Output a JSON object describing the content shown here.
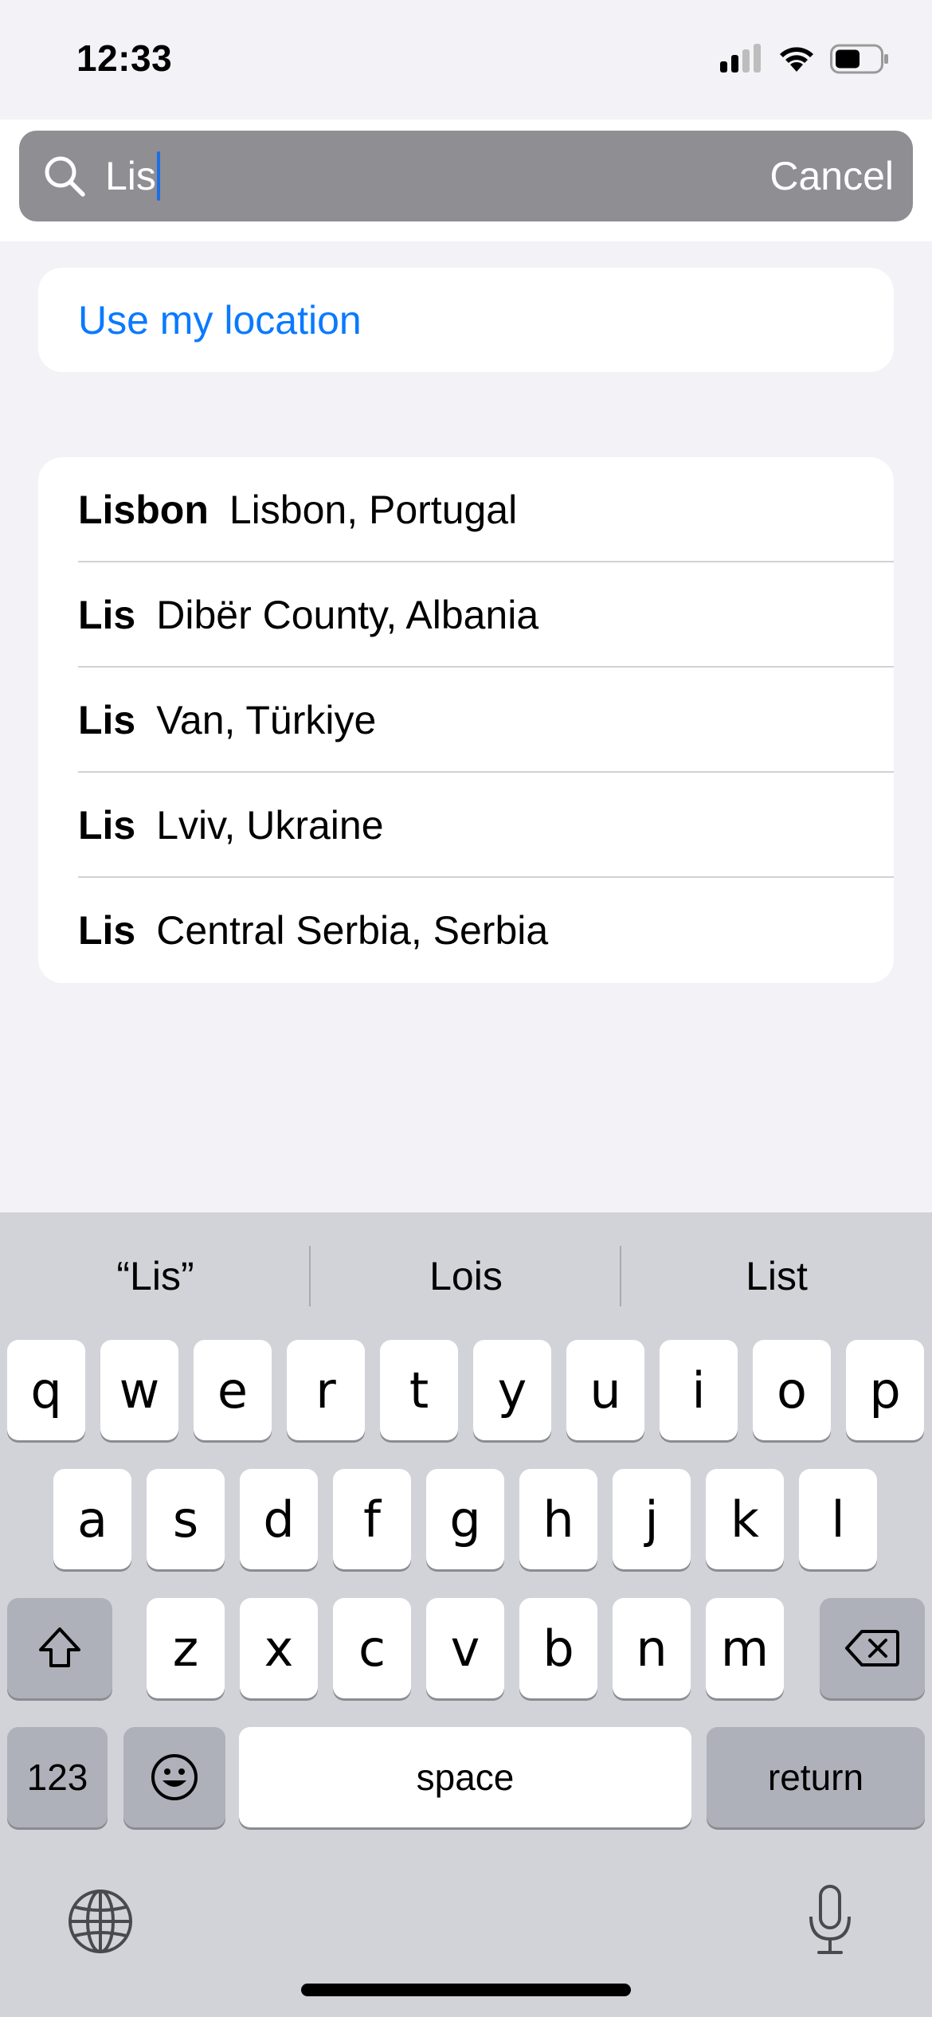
{
  "status_bar": {
    "time": "12:33"
  },
  "search": {
    "query": "Lis",
    "cancel_label": "Cancel"
  },
  "location": {
    "label": "Use my location"
  },
  "results": [
    {
      "name": "Lisbon",
      "region": "Lisbon, Portugal"
    },
    {
      "name": "Lis",
      "region": "Dibër County, Albania"
    },
    {
      "name": "Lis",
      "region": "Van, Türkiye"
    },
    {
      "name": "Lis",
      "region": "Lviv, Ukraine"
    },
    {
      "name": "Lis",
      "region": "Central Serbia, Serbia"
    }
  ],
  "keyboard": {
    "suggestions": [
      "“Lis”",
      "Lois",
      "List"
    ],
    "row1": [
      "q",
      "w",
      "e",
      "r",
      "t",
      "y",
      "u",
      "i",
      "o",
      "p"
    ],
    "row2": [
      "a",
      "s",
      "d",
      "f",
      "g",
      "h",
      "j",
      "k",
      "l"
    ],
    "row3": [
      "z",
      "x",
      "c",
      "v",
      "b",
      "n",
      "m"
    ],
    "numbers_label": "123",
    "space_label": "space",
    "return_label": "return"
  },
  "colors": {
    "accent": "#0a7aff",
    "search_bg": "#8e8e93",
    "keyboard_bg": "#d1d3d9"
  }
}
